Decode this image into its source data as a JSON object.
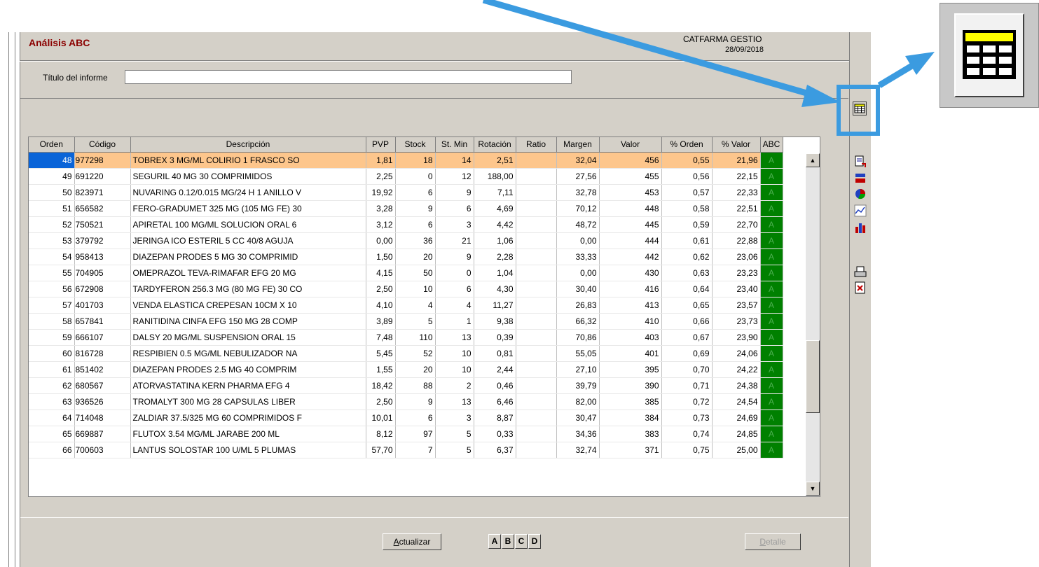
{
  "header": {
    "title": "Análisis ABC",
    "company": "CATFARMA GESTIO",
    "date": "28/09/2018"
  },
  "report_title": {
    "label": "Título del informe",
    "value": ""
  },
  "table": {
    "columns": [
      "Orden",
      "Código",
      "Descripción",
      "PVP",
      "Stock",
      "St. Min",
      "Rotación",
      "Ratio",
      "Margen",
      "Valor",
      "% Orden",
      "% Valor",
      "ABC"
    ],
    "rows": [
      [
        "48",
        "977298",
        "TOBREX 3 MG/ML COLIRIO 1 FRASCO SO",
        "1,81",
        "18",
        "14",
        "2,51",
        "",
        "32,04",
        "456",
        "0,55",
        "21,96",
        "A"
      ],
      [
        "49",
        "691220",
        "SEGURIL 40 MG 30 COMPRIMIDOS",
        "2,25",
        "0",
        "12",
        "188,00",
        "",
        "27,56",
        "455",
        "0,56",
        "22,15",
        "A"
      ],
      [
        "50",
        "823971",
        "NUVARING 0.12/0.015 MG/24 H 1 ANILLO V",
        "19,92",
        "6",
        "9",
        "7,11",
        "",
        "32,78",
        "453",
        "0,57",
        "22,33",
        "A"
      ],
      [
        "51",
        "656582",
        "FERO-GRADUMET 325 MG (105 MG FE) 30",
        "3,28",
        "9",
        "6",
        "4,69",
        "",
        "70,12",
        "448",
        "0,58",
        "22,51",
        "A"
      ],
      [
        "52",
        "750521",
        "APIRETAL 100 MG/ML SOLUCION ORAL 6",
        "3,12",
        "6",
        "3",
        "4,42",
        "",
        "48,72",
        "445",
        "0,59",
        "22,70",
        "A"
      ],
      [
        "53",
        "379792",
        "JERINGA ICO ESTERIL 5 CC 40/8 AGUJA",
        "0,00",
        "36",
        "21",
        "1,06",
        "",
        "0,00",
        "444",
        "0,61",
        "22,88",
        "A"
      ],
      [
        "54",
        "958413",
        "DIAZEPAN PRODES 5 MG 30 COMPRIMID",
        "1,50",
        "20",
        "9",
        "2,28",
        "",
        "33,33",
        "442",
        "0,62",
        "23,06",
        "A"
      ],
      [
        "55",
        "704905",
        "OMEPRAZOL TEVA-RIMAFAR EFG 20 MG",
        "4,15",
        "50",
        "0",
        "1,04",
        "",
        "0,00",
        "430",
        "0,63",
        "23,23",
        "A"
      ],
      [
        "56",
        "672908",
        "TARDYFERON 256.3 MG (80 MG FE) 30 CO",
        "2,50",
        "10",
        "6",
        "4,30",
        "",
        "30,40",
        "416",
        "0,64",
        "23,40",
        "A"
      ],
      [
        "57",
        "401703",
        "VENDA ELASTICA CREPESAN 10CM X 10",
        "4,10",
        "4",
        "4",
        "11,27",
        "",
        "26,83",
        "413",
        "0,65",
        "23,57",
        "A"
      ],
      [
        "58",
        "657841",
        "RANITIDINA CINFA EFG 150 MG 28 COMP",
        "3,89",
        "5",
        "1",
        "9,38",
        "",
        "66,32",
        "410",
        "0,66",
        "23,73",
        "A"
      ],
      [
        "59",
        "666107",
        "DALSY 20 MG/ML SUSPENSION ORAL 15",
        "7,48",
        "110",
        "13",
        "0,39",
        "",
        "70,86",
        "403",
        "0,67",
        "23,90",
        "A"
      ],
      [
        "60",
        "816728",
        "RESPIBIEN 0.5 MG/ML NEBULIZADOR NA",
        "5,45",
        "52",
        "10",
        "0,81",
        "",
        "55,05",
        "401",
        "0,69",
        "24,06",
        "A"
      ],
      [
        "61",
        "851402",
        "DIAZEPAN PRODES 2.5 MG 40 COMPRIM",
        "1,55",
        "20",
        "10",
        "2,44",
        "",
        "27,10",
        "395",
        "0,70",
        "24,22",
        "A"
      ],
      [
        "62",
        "680567",
        "ATORVASTATINA KERN PHARMA EFG 4",
        "18,42",
        "88",
        "2",
        "0,46",
        "",
        "39,79",
        "390",
        "0,71",
        "24,38",
        "A"
      ],
      [
        "63",
        "936526",
        "TROMALYT 300 MG 28 CAPSULAS LIBER",
        "2,50",
        "9",
        "13",
        "6,46",
        "",
        "82,00",
        "385",
        "0,72",
        "24,54",
        "A"
      ],
      [
        "64",
        "714048",
        "ZALDIAR 37.5/325 MG 60 COMPRIMIDOS F",
        "10,01",
        "6",
        "3",
        "8,87",
        "",
        "30,47",
        "384",
        "0,73",
        "24,69",
        "A"
      ],
      [
        "65",
        "669887",
        "FLUTOX 3.54 MG/ML JARABE 200 ML",
        "8,12",
        "97",
        "5",
        "0,33",
        "",
        "34,36",
        "383",
        "0,74",
        "24,85",
        "A"
      ],
      [
        "66",
        "700603",
        "LANTUS SOLOSTAR 100 U/ML 5 PLUMAS",
        "57,70",
        "7",
        "5",
        "6,37",
        "",
        "32,74",
        "371",
        "0,75",
        "25,00",
        "A"
      ]
    ]
  },
  "buttons": {
    "actualizar": "Actualizar",
    "abc": [
      "A",
      "B",
      "C",
      "D"
    ],
    "detalle": "Detalle"
  },
  "toolbar": {
    "icons": [
      "grid-view-icon",
      "export-icon",
      "bar-chart-icon",
      "pie-chart-icon",
      "line-chart-icon",
      "column-chart-icon",
      "print-icon",
      "print-preview-icon"
    ]
  },
  "colors": {
    "title": "#8b0000",
    "selected_row": "#fdc68c",
    "abc_cell": "#008000",
    "callout": "#3b9be0"
  }
}
